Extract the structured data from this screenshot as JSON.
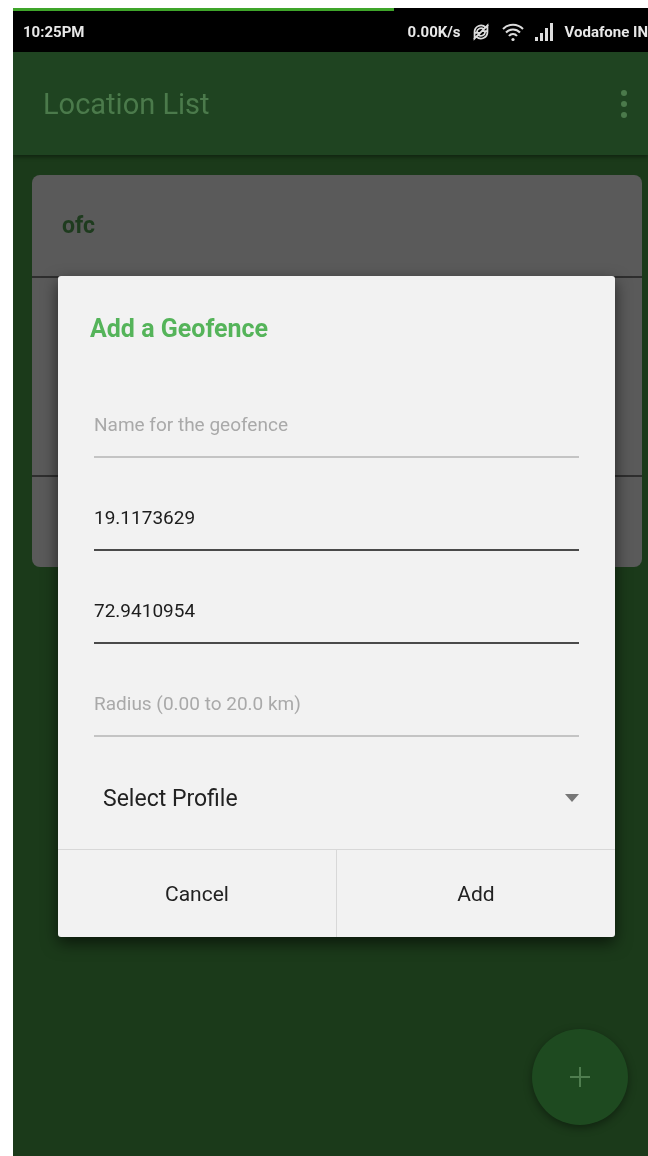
{
  "status_bar": {
    "progress": {
      "level": 0.6
    },
    "time": "10:25PM",
    "speed": "0.00K/s",
    "carrier": "Vodafone IN"
  },
  "app_bar": {
    "title": "Location List"
  },
  "location_card": {
    "name": "ofc"
  },
  "dialog": {
    "title": "Add a Geofence",
    "fields": [
      {
        "placeholder": "Name for the geofence"
      },
      {
        "value": "19.1173629"
      },
      {
        "value": "72.9410954"
      },
      {
        "placeholder": "Radius (0.00 to 20.0 km)"
      }
    ],
    "dropdown": {
      "label": "Select Profile"
    },
    "buttons": [
      "Cancel",
      "Add"
    ]
  }
}
